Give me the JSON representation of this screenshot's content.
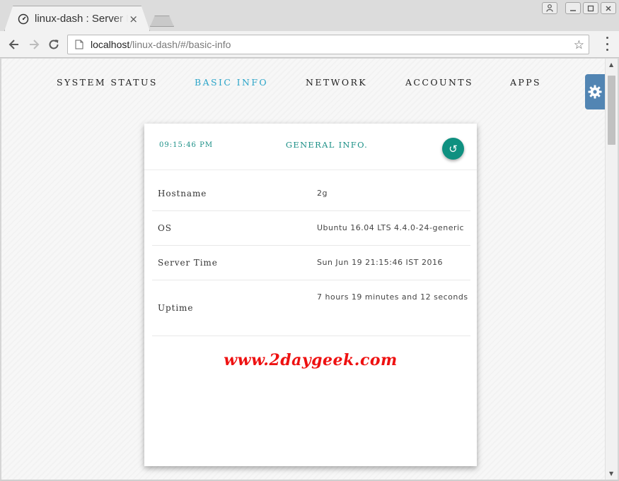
{
  "browser": {
    "tab_title": "linux-dash : Server Monitoring Web Dashboard",
    "tab_close": "×",
    "url_host": "localhost",
    "url_path": "/linux-dash/#/basic-info"
  },
  "nav": {
    "items": [
      {
        "label": "SYSTEM STATUS",
        "active": false
      },
      {
        "label": "BASIC INFO",
        "active": true
      },
      {
        "label": "NETWORK",
        "active": false
      },
      {
        "label": "ACCOUNTS",
        "active": false
      },
      {
        "label": "APPS",
        "active": false
      }
    ]
  },
  "card": {
    "time": "09:15:46 PM",
    "title": "GENERAL INFO.",
    "refresh_glyph": "↺",
    "rows": [
      {
        "key": "Hostname",
        "value": "2g"
      },
      {
        "key": "OS",
        "value": "Ubuntu 16.04 LTS 4.4.0-24-generic"
      },
      {
        "key": "Server Time",
        "value": "Sun Jun 19 21:15:46 IST 2016"
      },
      {
        "key": "Uptime",
        "value": "7 hours 19 minutes and 12 seconds"
      }
    ]
  },
  "watermark": "www.2daygeek.com",
  "icons": {
    "favicon": "dashboard-gauge-icon",
    "back": "arrow-left-icon",
    "forward": "arrow-right-icon",
    "reload": "reload-icon",
    "star": "star-icon",
    "menu": "kebab-menu-icon",
    "settings": "gear-icon"
  },
  "colors": {
    "accent_active": "#2aa4c8",
    "card_teal": "#1a8f86",
    "refresh_button": "#0f9080",
    "settings_tab": "#5285b3",
    "watermark": "#ee1111"
  }
}
